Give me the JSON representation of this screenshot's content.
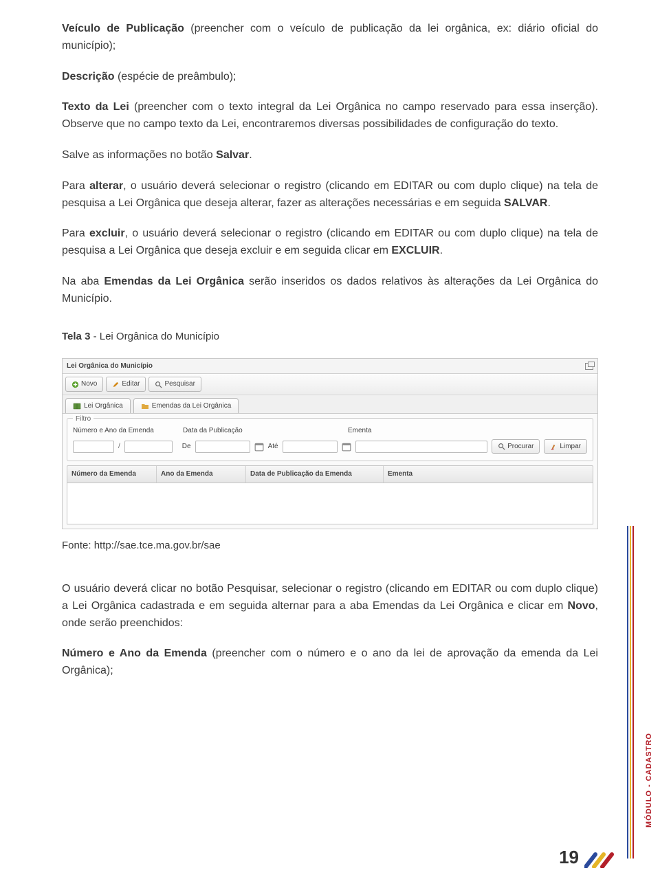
{
  "paragraphs": {
    "p1_a": "Veículo de Publicação",
    "p1_b": " (preencher com o veículo de publicação da lei orgânica, ex: diário oficial do município);",
    "p2_a": "Descrição",
    "p2_b": " (espécie de preâmbulo);",
    "p3_a": "Texto da Lei",
    "p3_b": " (preencher com o texto integral da Lei Orgânica no campo reservado para essa inserção). Observe que no campo texto da Lei, encontraremos diversas possibilidades de configuração do texto.",
    "p4_a": "Salve as informações no botão ",
    "p4_b": "Salvar",
    "p4_c": ".",
    "p5_a": "Para ",
    "p5_b": "alterar",
    "p5_c": ", o usuário deverá selecionar o registro (clicando em EDITAR ou com duplo clique) na tela de pesquisa a Lei Orgânica que deseja alterar, fazer as alterações necessárias e em seguida ",
    "p5_d": "SALVAR",
    "p5_e": ".",
    "p6_a": "Para ",
    "p6_b": "excluir",
    "p6_c": ", o usuário deverá selecionar o registro (clicando em EDITAR ou com duplo clique) na tela de pesquisa a Lei Orgânica que deseja excluir e em seguida clicar em ",
    "p6_d": "EXCLUIR",
    "p6_e": ".",
    "p7_a": "Na aba ",
    "p7_b": "Emendas da Lei Orgânica",
    "p7_c": " serão inseridos os dados relativos às alterações da Lei Orgânica do Município.",
    "caption_a": "Tela 3",
    "caption_b": " - Lei Orgânica do Município",
    "source": "Fonte: http://sae.tce.ma.gov.br/sae",
    "p8_a": "O usuário deverá clicar no botão Pesquisar, selecionar o registro (clicando em EDITAR ou com duplo clique) a Lei Orgânica cadastrada e em seguida alternar para a aba Emendas da Lei Orgânica e clicar em ",
    "p8_b": "Novo",
    "p8_c": ", onde serão preenchidos:",
    "p9_a": "Número e Ano da Emenda",
    "p9_b": " (preencher com o número e o ano da lei de aprovação da emenda da Lei Orgânica);"
  },
  "ui": {
    "title": "Lei Orgânica do Município",
    "toolbar": {
      "novo": "Novo",
      "editar": "Editar",
      "pesquisar": "Pesquisar"
    },
    "tabs": {
      "lei": "Lei Orgânica",
      "emendas": "Emendas da Lei Orgânica"
    },
    "filtro": {
      "legend": "Filtro",
      "num_ano": "Número e Ano da Emenda",
      "data_pub": "Data da Publicação",
      "ementa": "Ementa",
      "de": "De",
      "ate": "Até",
      "slash": "/",
      "procurar": "Procurar",
      "limpar": "Limpar"
    },
    "grid": {
      "c1": "Número da Emenda",
      "c2": "Ano da Emenda",
      "c3": "Data de Publicação da Emenda",
      "c4": "Ementa"
    }
  },
  "side_label": "MÓDULO - CADASTRO",
  "page_number": "19"
}
